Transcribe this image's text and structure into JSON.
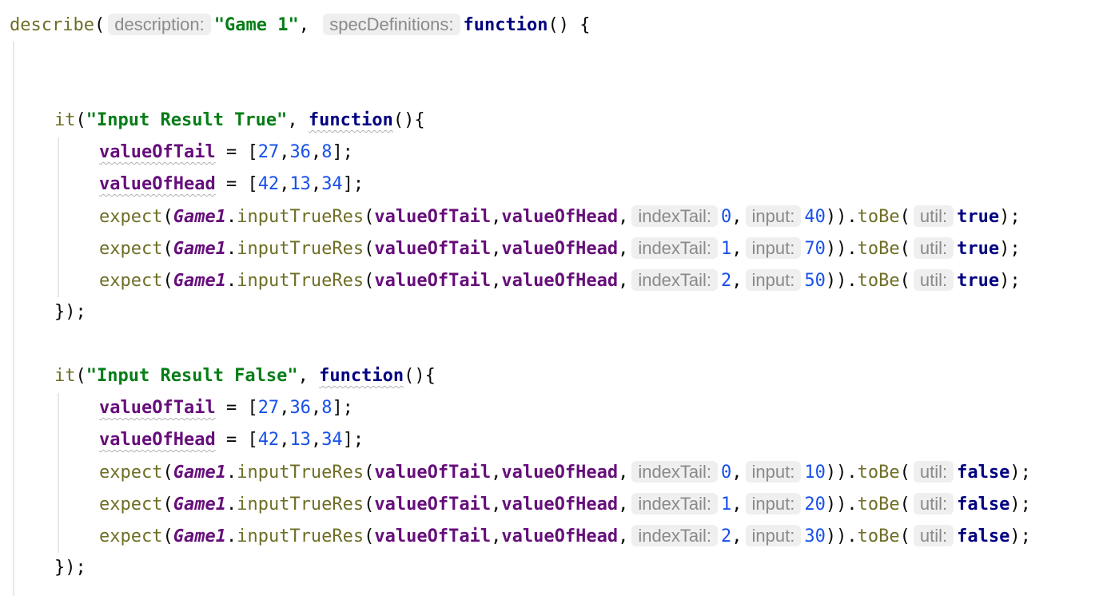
{
  "describe": {
    "fn": "describe",
    "hint_description": "description:",
    "name": "\"Game 1\"",
    "hint_specs": "specDefinitions:",
    "keyword": "function",
    "tail": "() {"
  },
  "it_true": {
    "fn": "it",
    "name": "\"Input Result True\"",
    "keyword": "function",
    "tail": "(){",
    "close": "});"
  },
  "it_false": {
    "fn": "it",
    "name": "\"Input Result False\"",
    "keyword": "function",
    "tail": "(){",
    "close": "});"
  },
  "vars": {
    "tail_name": "valueOfTail",
    "head_name": "valueOfHead",
    "tail_value": [
      "27",
      "36",
      "8"
    ],
    "head_value": [
      "42",
      "13",
      "34"
    ]
  },
  "call": {
    "expect": "expect",
    "cls": "Game1",
    "method": "inputTrueRes",
    "hint_index": "indexTail:",
    "hint_input": "input:",
    "tobe": "toBe",
    "hint_util": "util:"
  },
  "expects_true": [
    {
      "index": "0",
      "input": "40",
      "result": "true"
    },
    {
      "index": "1",
      "input": "70",
      "result": "true"
    },
    {
      "index": "2",
      "input": "50",
      "result": "true"
    }
  ],
  "expects_false": [
    {
      "index": "0",
      "input": "10",
      "result": "false"
    },
    {
      "index": "1",
      "input": "20",
      "result": "false"
    },
    {
      "index": "2",
      "input": "30",
      "result": "false"
    }
  ]
}
